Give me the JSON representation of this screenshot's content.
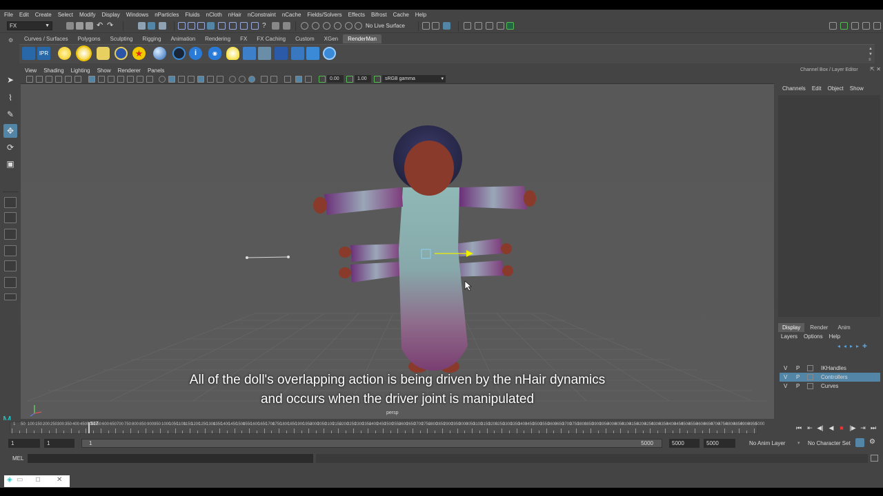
{
  "menubar": [
    "File",
    "Edit",
    "Create",
    "Select",
    "Modify",
    "Display",
    "Windows",
    "nParticles",
    "Fluids",
    "nCloth",
    "nHair",
    "nConstraint",
    "nCache",
    "Fields/Solvers",
    "Effects",
    "Bifrost",
    "Cache",
    "Help"
  ],
  "status_line": {
    "menu_set": "FX",
    "live_surface": "No Live Surface"
  },
  "shelf": {
    "tabs": [
      "Curves / Surfaces",
      "Polygons",
      "Sculpting",
      "Rigging",
      "Animation",
      "Rendering",
      "FX",
      "FX Caching",
      "Custom",
      "XGen",
      "RenderMan"
    ],
    "active_tab": "RenderMan",
    "icons": [
      "renderman-render-icon",
      "ipr-icon",
      "sun-light-icon",
      "env-light-icon",
      "area-light-icon",
      "daylight-icon",
      "rman-star-icon",
      "material-sphere-icon",
      "glass-sphere-icon",
      "info-icon",
      "eye-icon",
      "bulb-icon",
      "grid-icon",
      "image-icon",
      "globe-icon",
      "chart-icon",
      "refresh-icon",
      "help-icon"
    ],
    "ipr_label": "IPR"
  },
  "viewport": {
    "menu": [
      "View",
      "Shading",
      "Lighting",
      "Show",
      "Renderer",
      "Panels"
    ],
    "exposure": "0.00",
    "gamma": "1.00",
    "color_space": "sRGB gamma",
    "camera": "persp",
    "subtitle_line1": "All of the doll's overlapping action is being driven by the nHair dynamics",
    "subtitle_line2": "and occurs when the driver joint is manipulated"
  },
  "channel_box": {
    "title": "Channel Box / Layer Editor",
    "menu": [
      "Channels",
      "Edit",
      "Object",
      "Show"
    ],
    "layer_tabs": [
      "Display",
      "Render",
      "Anim"
    ],
    "active_layer_tab": "Display",
    "layer_menu": [
      "Layers",
      "Options",
      "Help"
    ],
    "layers": [
      {
        "v": "V",
        "p": "P",
        "name": "IKHandles",
        "selected": false
      },
      {
        "v": "V",
        "p": "P",
        "name": "Controllers",
        "selected": true
      },
      {
        "v": "V",
        "p": "P",
        "name": "Curves",
        "selected": false
      }
    ]
  },
  "timeline": {
    "ticks": [
      "1",
      "50",
      "100",
      "150",
      "200",
      "250",
      "300",
      "350",
      "400",
      "450",
      "500",
      "550",
      "600",
      "650",
      "700",
      "750",
      "800",
      "850",
      "900",
      "950",
      "1000",
      "1050",
      "1100",
      "1150",
      "1200",
      "1250",
      "1300",
      "1350",
      "1400",
      "1450",
      "1500",
      "1550",
      "1600",
      "1650",
      "1700",
      "1750",
      "1800",
      "1850",
      "1900",
      "1950",
      "2000",
      "2050",
      "2100",
      "2150",
      "2200",
      "2250",
      "2300",
      "2350",
      "2400",
      "2450",
      "2500",
      "2550",
      "2600",
      "2650",
      "2700",
      "2750",
      "2800",
      "2850",
      "2900",
      "2950",
      "3000",
      "3050",
      "3100",
      "3150",
      "3200",
      "3250",
      "3300",
      "3350",
      "3400",
      "3450",
      "3500",
      "3550",
      "3600",
      "3650",
      "3700",
      "3750",
      "3800",
      "3850",
      "3900",
      "3950",
      "4000",
      "4050",
      "4100",
      "4150",
      "4200",
      "4250",
      "4300",
      "4350",
      "4400",
      "4450",
      "4500",
      "4550",
      "4600",
      "4650",
      "4700",
      "4750",
      "4800",
      "4850",
      "4900",
      "4950",
      "5000"
    ],
    "current_frame": "517"
  },
  "range": {
    "start": "1",
    "playback_start": "1",
    "slider_start": "1",
    "slider_end": "5000",
    "playback_end": "5000",
    "end": "5000",
    "anim_layer": "No Anim Layer",
    "character_set": "No Character Set"
  },
  "command_line": {
    "label": "MEL"
  }
}
